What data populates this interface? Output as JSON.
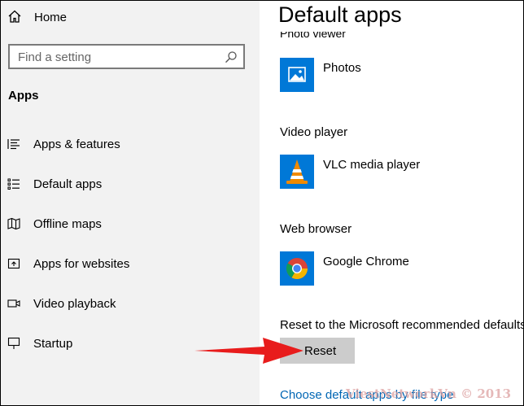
{
  "sidebar": {
    "home_label": "Home",
    "search_placeholder": "Find a setting",
    "section_title": "Apps",
    "items": [
      {
        "label": "Apps & features",
        "icon": "apps-features-icon"
      },
      {
        "label": "Default apps",
        "icon": "default-apps-icon"
      },
      {
        "label": "Offline maps",
        "icon": "offline-maps-icon"
      },
      {
        "label": "Apps for websites",
        "icon": "apps-websites-icon"
      },
      {
        "label": "Video playback",
        "icon": "video-playback-icon"
      },
      {
        "label": "Startup",
        "icon": "startup-icon"
      }
    ]
  },
  "main": {
    "title": "Default apps",
    "groups": [
      {
        "heading": "Photo viewer",
        "app": "Photos",
        "icon": "photos-icon"
      },
      {
        "heading": "Video player",
        "app": "VLC media player",
        "icon": "vlc-icon"
      },
      {
        "heading": "Web browser",
        "app": "Google Chrome",
        "icon": "chrome-icon"
      }
    ],
    "reset_text": "Reset to the Microsoft recommended defaults",
    "reset_button": "Reset",
    "choose_link": "Choose default apps by file type"
  },
  "watermark": "ViestNetworkVn © 2013",
  "colors": {
    "sidebar_bg": "#f2f2f2",
    "accent_blue": "#0078d7",
    "link_blue": "#0066b4",
    "button_gray": "#cccccc",
    "arrow_red": "#e81c1c"
  }
}
